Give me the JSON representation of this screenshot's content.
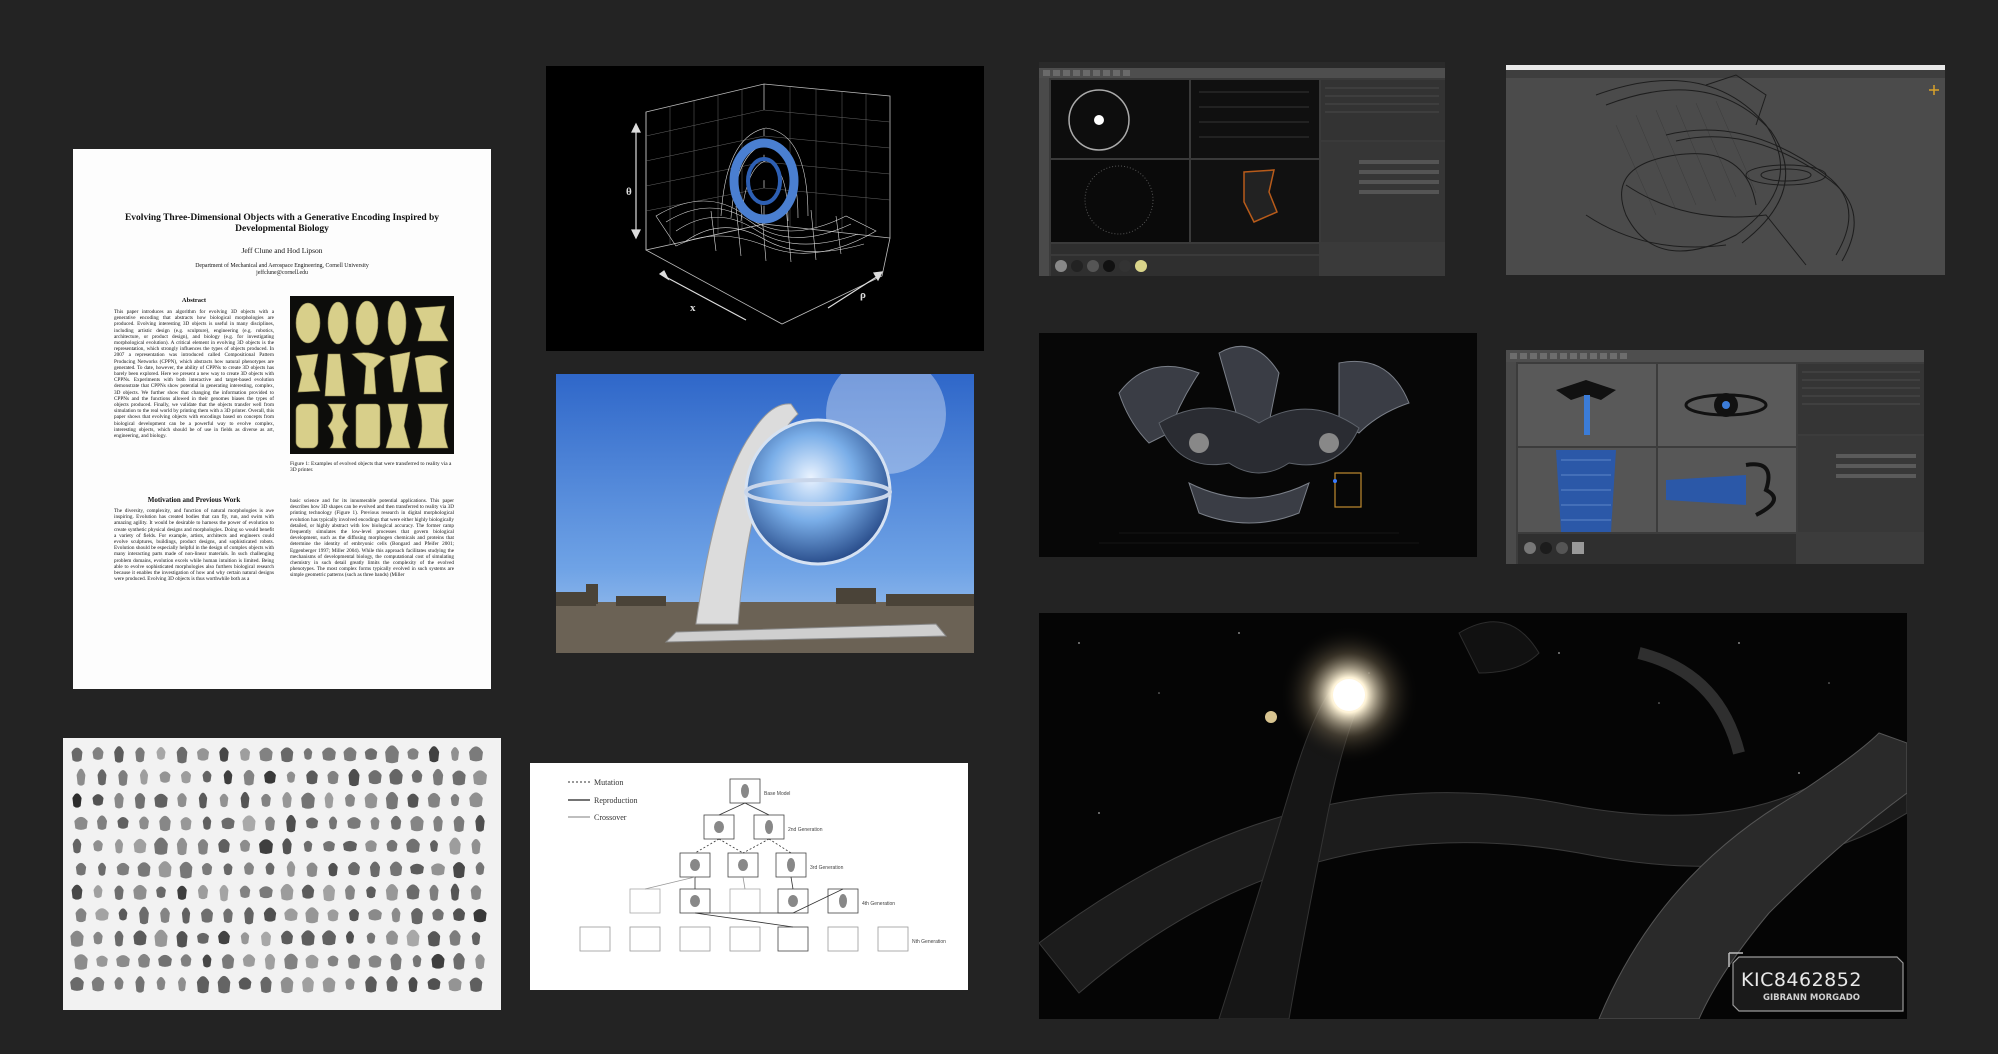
{
  "paper": {
    "title": "Evolving Three-Dimensional Objects with a Generative Encoding Inspired by Developmental Biology",
    "authors": "Jeff Clune  and  Hod Lipson",
    "affiliation": "Department of Mechanical and Aerospace Engineering, Cornell University",
    "email": "jeffclune@cornell.edu",
    "abstract_heading": "Abstract",
    "abstract_text": "This paper introduces an algorithm for evolving 3D objects with a generative encoding that abstracts how biological morphologies are produced. Evolving interesting 3D objects is useful in many disciplines, including artistic design (e.g. sculpture), engineering (e.g. robotics, architecture, or product design), and biology (e.g. for investigating morphological evolution). A critical element in evolving 3D objects is the representation, which strongly influences the types of objects produced. In 2007 a representation was introduced called Compositional Pattern Producing Networks (CPPN), which abstracts how natural phenotypes are generated. To date, however, the ability of CPPNs to create 3D objects has barely been explored. Here we present a new way to create 3D objects with CPPNs. Experiments with both interactive and target-based evolution demonstrate that CPPNs show potential in generating interesting, complex, 3D objects. We further show that changing the information provided to CPPNs and the functions allowed in their genomes biases the types of objects produced. Finally, we validate that the objects transfer well from simulation to the real world by printing them with a 3D printer. Overall, this paper shows that evolving objects with encodings based on concepts from biological development can be a powerful way to evolve complex, interesting objects, which should be of use in fields as diverse as art, engineering, and biology.",
    "figure_caption": "Figure 1: Examples of evolved objects that were transferred to reality via a 3D printer.",
    "section_heading": "Motivation and Previous Work",
    "body_left": "The diversity, complexity, and function of natural morphologies is awe inspiring. Evolution has created bodies that can fly, run, and swim with amazing agility. It would be desirable to harness the power of evolution to create synthetic physical designs and morphologies. Doing so would benefit a variety of fields. For example, artists, architects and engineers could evolve sculptures, buildings, product designs, and sophisticated robots. Evolution should be especially helpful in the design of complex objects with many interacting parts made of non-linear materials. In such challenging problem domains, evolution excels while human intuition is limited. Being able to evolve sophisticated morphologies also furthers biological research because it enables the investigation of how and why certain natural designs were produced. Evolving 3D objects is thus worthwhile both as a",
    "body_right": "basic science and for its innumerable potential applications. This paper describes how 3D shapes can be evolved and then transferred to reality via 3D printing technology (Figure 1). Previous research in digital morphological evolution has typically involved encodings that were either highly biologically detailed, or highly abstract with low biological accuracy. The former camp frequently simulates the low-level processes that govern biological development, such as the diffusing morphogen chemicals and proteins that determine the identity of embryonic cells (Bongard and Pfeifer 2001; Eggenberger 1997; Miller 2004). While this approach facilitates studying the mechanisms of developmental biology, the computational cost of simulating chemistry in such detail greatly limits the complexity of the evolved phenotypes. The most complex forms typically evolved in such systems are simple geometric patterns (such as three bands) (Miller"
  },
  "plot3d": {
    "axis_left": "θ",
    "axis_front": "x",
    "axis_right": "ρ"
  },
  "tree": {
    "legend": [
      "Mutation",
      "Reproduction",
      "Crossover"
    ],
    "generations": [
      "Base Model",
      "2nd Generation",
      "3rd Generation",
      "4th Generation",
      "Nth Generation"
    ]
  },
  "render_badge": {
    "title": "KIC8462852",
    "subtitle": "GIBRANN MORGADO"
  },
  "colors": {
    "background": "#232323",
    "accent_blue": "#4a7fd1"
  }
}
